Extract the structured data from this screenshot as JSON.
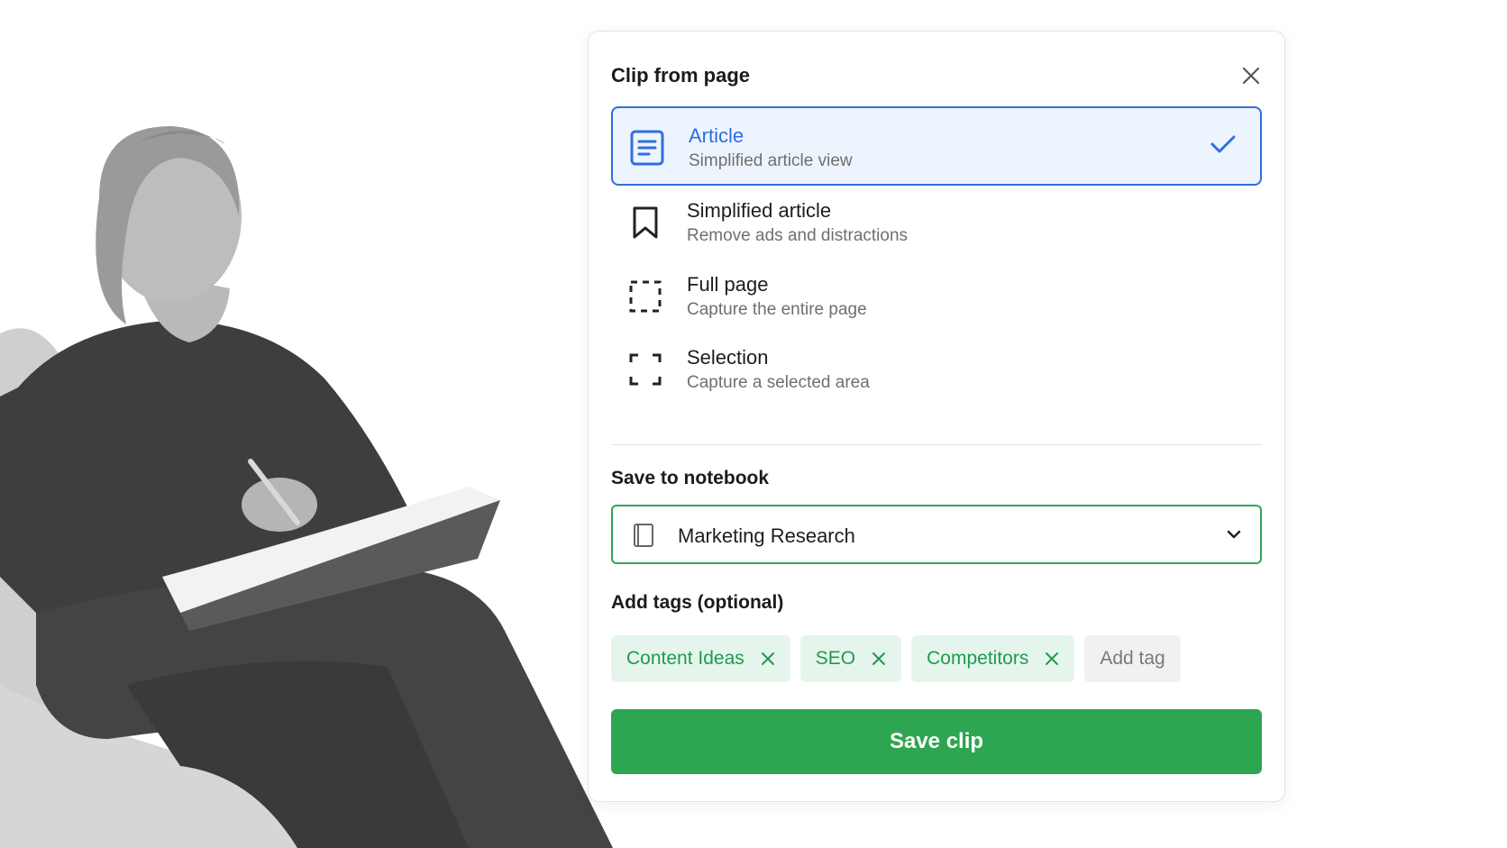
{
  "panel": {
    "title": "Clip from page",
    "options": [
      {
        "title": "Article",
        "subtitle": "Simplified article view",
        "icon": "article-icon",
        "selected": true
      },
      {
        "title": "Simplified article",
        "subtitle": "Remove ads and distractions",
        "icon": "bookmark-icon",
        "selected": false
      },
      {
        "title": "Full page",
        "subtitle": "Capture the entire page",
        "icon": "full-page-icon",
        "selected": false
      },
      {
        "title": "Selection",
        "subtitle": "Capture a selected area",
        "icon": "selection-icon",
        "selected": false
      }
    ],
    "notebook": {
      "label": "Save to notebook",
      "value": "Marketing Research",
      "icon": "notebook-icon"
    },
    "tags": {
      "label": "Add tags (optional)",
      "items": [
        "Content Ideas",
        "SEO",
        "Competitors"
      ],
      "add_label": "Add tag"
    },
    "save_label": "Save clip"
  },
  "colors": {
    "accent_blue": "#2f6fde",
    "selected_bg": "#eef4fd",
    "green": "#2ea550",
    "tag_bg": "#e6f5ec",
    "tag_text": "#1f9a4e"
  }
}
